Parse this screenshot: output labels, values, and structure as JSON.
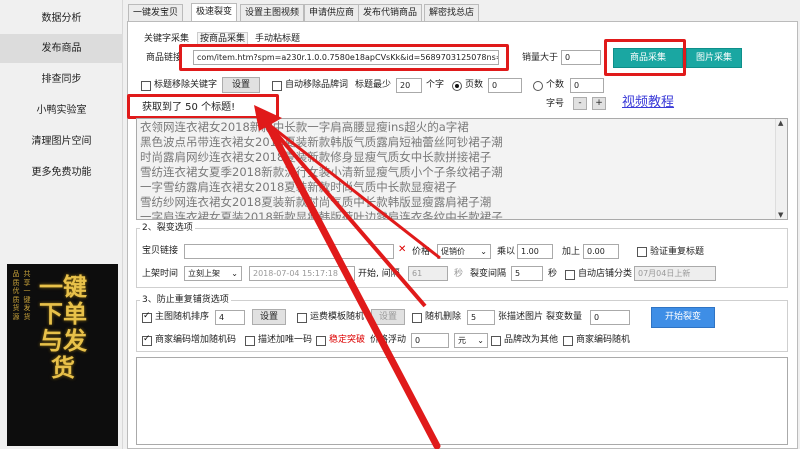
{
  "sidebar": {
    "items": [
      {
        "label": "数据分析"
      },
      {
        "label": "发布商品"
      },
      {
        "label": "排查同步"
      },
      {
        "label": "小鸭实验室"
      },
      {
        "label": "清理图片空间"
      },
      {
        "label": "更多免费功能"
      }
    ],
    "banner": {
      "main_text": "一键下单与发货",
      "side_text_left": "品质优质货源",
      "side_text_right": "共享一键发货"
    }
  },
  "tabs": [
    "一键发宝贝",
    "极速裂变",
    "设置主图视频",
    "申请供应商",
    "发布代销商品",
    "解密找总店"
  ],
  "subtabs": [
    "关键字采集",
    "按商品采集",
    "手动粘标题"
  ],
  "collect": {
    "link_label": "商品链接",
    "link_value": "com/item.htm?spm=a230r.1.0.0.7580e18apCVsKk&id=5689703125078ns=1&",
    "sales_label": "销量大于",
    "sales_value": "0",
    "collect_button": "商品采集",
    "image_button": "图片采集"
  },
  "options_row": {
    "remove_keyword_label": "标题移除关键字",
    "settings_button": "设置",
    "auto_remove_brand_label": "自动移除品牌词",
    "title_min_label": "标题最少",
    "title_min_value": "20",
    "char_label": "个字",
    "pages_label": "页数",
    "pages_value": "0",
    "count_label": "个数",
    "count_value": "0",
    "font_size_label": "字号",
    "minus": "-",
    "plus": "+",
    "video_link": "视频教程"
  },
  "status_text": "获取到了 50 个标题!",
  "titles": [
    "衣领网连衣裙女2018新款中长款一字肩高腰显瘦ins超火的a字裙",
    "黑色波点吊带连衣裙女2018夏装新款韩版气质露肩短袖蕾丝阿钞裙子潮",
    "时尚露肩网纱连衣裙女2018夏装新款修身显瘦气质女中长款拼接裙子",
    "雪纺连衣裙女夏季2018新款流行女装小清新显瘦气质小个子条纹裙子潮",
    "一字雪纺露肩连衣裙女2018夏装新款时尚气质中长款显瘦裙子",
    "雪纺纱网连衣裙女2018夏装新款时尚气质中长款韩版显瘦露肩裙子潮",
    "一字肩连衣裙女夏装2018新款显瘦韩版荷叶边露肩连衣条纹中长款裙子"
  ],
  "split_section": {
    "title": "2、裂变选项",
    "item_link_label": "宝贝链接",
    "price_label": "价格",
    "price_mode": "促销价",
    "multiply_label": "乘以",
    "multiply_value": "1.00",
    "add_label": "加上",
    "add_value": "0.00",
    "verify_title_label": "验证重复标题",
    "list_time_label": "上架时间",
    "list_time_mode": "立刻上架",
    "datetime_value": "2018-07-04 15:17:18",
    "start_interval_label": "开始, 间隔",
    "interval_value": "61",
    "seconds_label": "秒",
    "split_interval_label": "裂变间隔",
    "split_interval_value": "5",
    "seconds2_label": "秒",
    "auto_shop_category_label": "自动店铺分类",
    "shop_category_value": "07月04日上新"
  },
  "dedupe_section": {
    "title": "3、防止重复铺货选项",
    "main_image_shuffle_label": "主图随机排序",
    "shuffle_value": "4",
    "settings_button": "设置",
    "shipping_template_label": "运费模板随机",
    "shipping_settings_button": "设置",
    "random_delete_label": "随机删除",
    "random_delete_value": "5",
    "desc_images_label": "张描述图片",
    "split_count_label": "裂变数量",
    "split_count_value": "0",
    "start_button": "开始裂变",
    "merchant_code_label": "商家编码增加随机码",
    "desc_add_code_label": "描述加唯一码",
    "stable_label": "稳定突破",
    "price_float_label": "价格浮动",
    "price_float_value": "0",
    "unit_value": "元",
    "category_change_label": "品牌改为其他",
    "merchant_random_label": "商家编码随机"
  }
}
